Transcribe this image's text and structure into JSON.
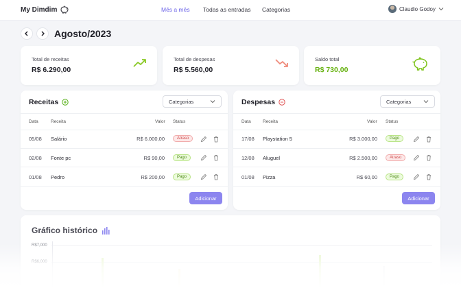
{
  "app": {
    "brand": "My Dimdim"
  },
  "nav": {
    "items": [
      "Mês a mês",
      "Todas as entradas",
      "Categorias"
    ],
    "active": "Mês a mês"
  },
  "user": {
    "name": "Claudio Godoy"
  },
  "period": {
    "label": "Agosto/2023"
  },
  "summary": {
    "receitas": {
      "label": "Total de receitas",
      "value": "R$ 6.290,00"
    },
    "despesas": {
      "label": "Total de despesas",
      "value": "R$ 5.560,00"
    },
    "saldo": {
      "label": "Saldo total",
      "value": "R$ 730,00"
    }
  },
  "colors": {
    "accent": "#6b63e8",
    "button": "#8c85ef",
    "income": "#7fc41c",
    "expense": "#e07b6e",
    "positive": "#65b10e"
  },
  "receitas": {
    "title": "Receitas",
    "select": "Categorias",
    "columns": [
      "Data",
      "Receita",
      "Valor",
      "Status"
    ],
    "rows": [
      {
        "date": "05/08",
        "name": "Salário",
        "value": "R$ 6.000,00",
        "status": "Atraso"
      },
      {
        "date": "02/08",
        "name": "Fonte pc",
        "value": "R$ 90,00",
        "status": "Pago"
      },
      {
        "date": "01/08",
        "name": "Pedro",
        "value": "R$ 200,00",
        "status": "Pago"
      }
    ],
    "add": "Adicionar"
  },
  "despesas": {
    "title": "Despesas",
    "select": "Categorias",
    "columns": [
      "Data",
      "Receita",
      "Valor",
      "Status"
    ],
    "rows": [
      {
        "date": "17/08",
        "name": "Playstation 5",
        "value": "R$ 3.000,00",
        "status": "Pago"
      },
      {
        "date": "12/08",
        "name": "Aluguel",
        "value": "R$ 2.500,00",
        "status": "Atraso"
      },
      {
        "date": "01/08",
        "name": "Pizza",
        "value": "R$ 60,00",
        "status": "Pago"
      }
    ],
    "add": "Adicionar"
  },
  "chart": {
    "title": "Gráfico histórico",
    "y_ticks": [
      "R$7,000",
      "R$6,000"
    ]
  }
}
